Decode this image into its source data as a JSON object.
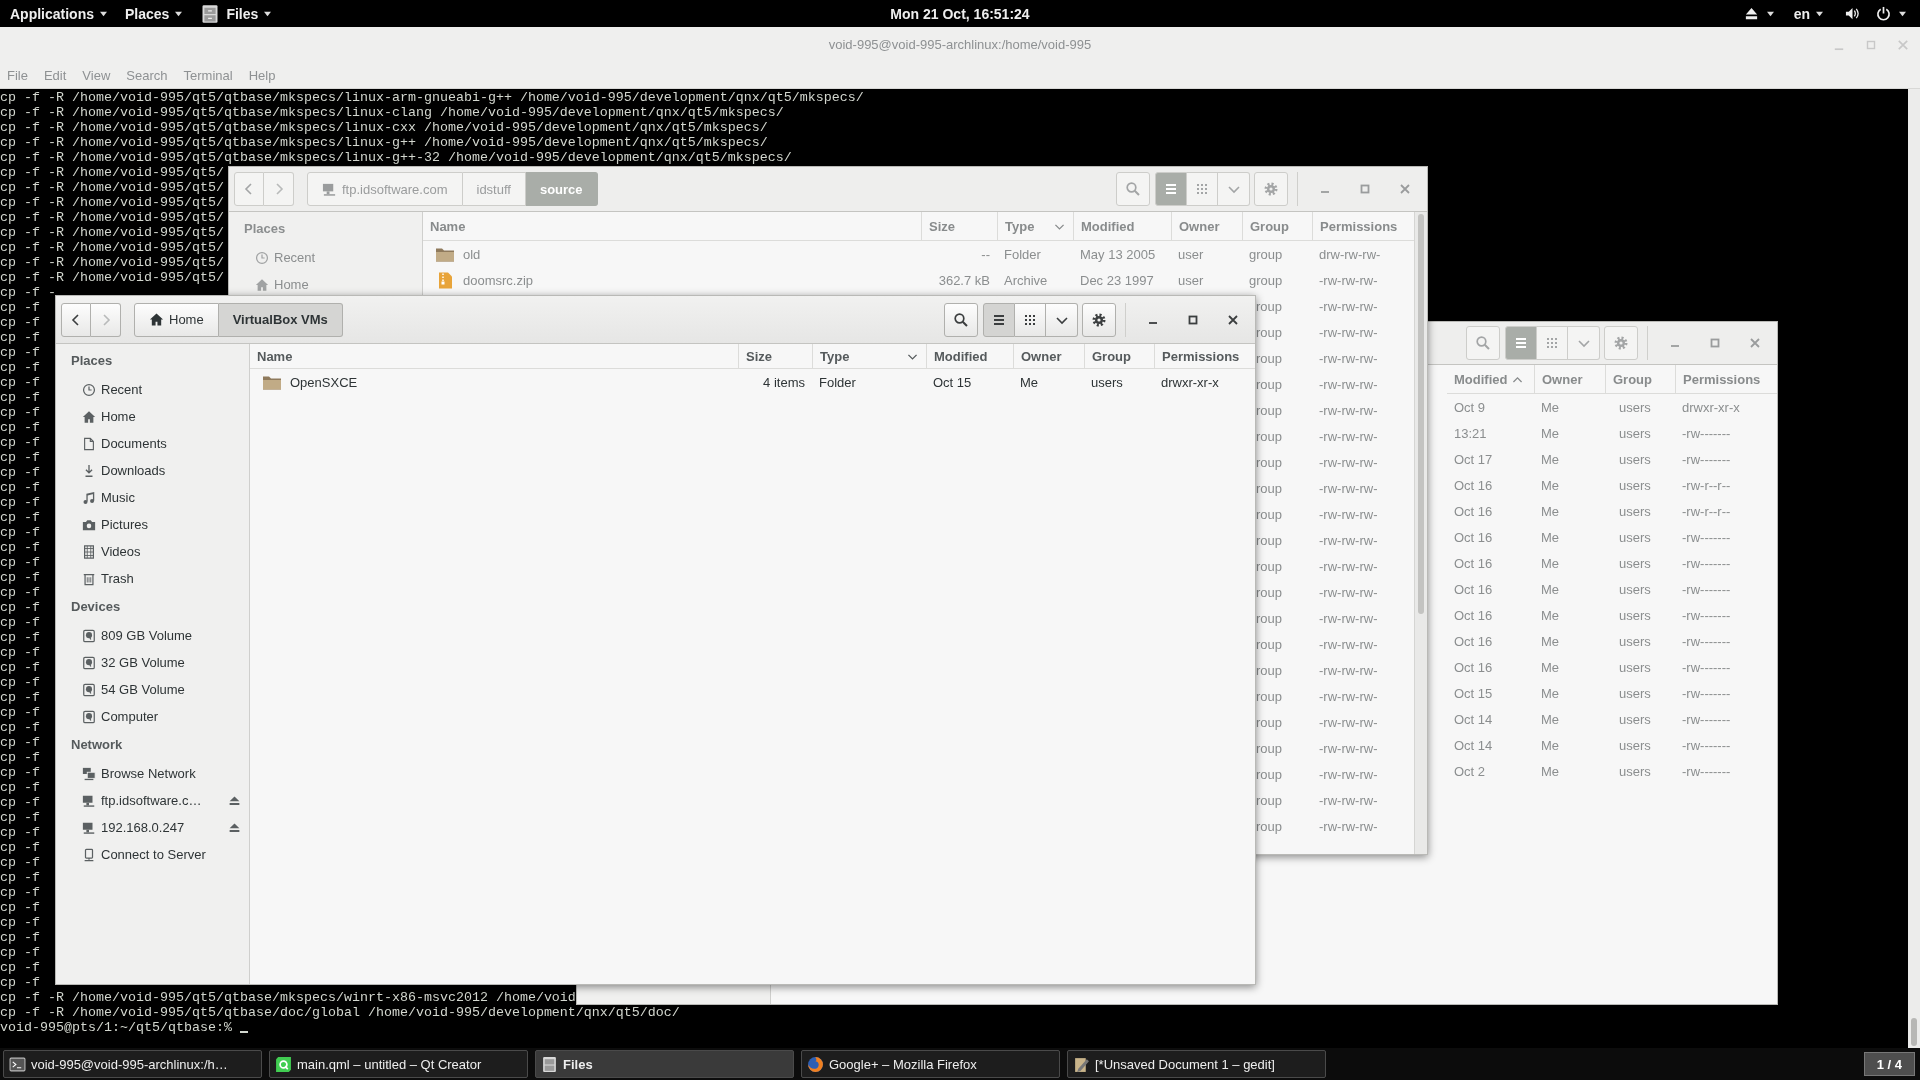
{
  "top_bar": {
    "menus": [
      {
        "label": "Applications"
      },
      {
        "label": "Places"
      },
      {
        "label": "Files"
      }
    ],
    "clock": "Mon 21 Oct, 16:51:24",
    "keyboard_layout": "en"
  },
  "terminal": {
    "title": "void-995@void-995-archlinux:/home/void-995",
    "menu": [
      "File",
      "Edit",
      "View",
      "Search",
      "Terminal",
      "Help"
    ],
    "lines": [
      "cp -f -R /home/void-995/qt5/qtbase/mkspecs/linux-arm-gnueabi-g++ /home/void-995/development/qnx/qt5/mkspecs/",
      "cp -f -R /home/void-995/qt5/qtbase/mkspecs/linux-clang /home/void-995/development/qnx/qt5/mkspecs/",
      "cp -f -R /home/void-995/qt5/qtbase/mkspecs/linux-cxx /home/void-995/development/qnx/qt5/mkspecs/",
      "cp -f -R /home/void-995/qt5/qtbase/mkspecs/linux-g++ /home/void-995/development/qnx/qt5/mkspecs/",
      "cp -f -R /home/void-995/qt5/qtbase/mkspecs/linux-g++-32 /home/void-995/development/qnx/qt5/mkspecs/",
      "cp -f -R /home/void-995/qt5/",
      "cp -f -R /home/void-995/qt5/",
      "cp -f -R /home/void-995/qt5/",
      "cp -f -R /home/void-995/qt5/",
      "cp -f -R /home/void-995/qt5/",
      "cp -f -R /home/void-995/qt5/",
      "cp -f -R /home/void-995/qt5/",
      "cp -f -R /home/void-995/qt5/",
      "cp -f -",
      "cp -f",
      "cp -f",
      "cp -f",
      "cp -f",
      "cp -f",
      "cp -f",
      "cp -f",
      "cp -f",
      "cp -f",
      "cp -f",
      "cp -f",
      "cp -f",
      "cp -f",
      "cp -f",
      "cp -f",
      "cp -f",
      "cp -f",
      "cp -f",
      "cp -f",
      "cp -f",
      "cp -f",
      "cp -f",
      "cp -f",
      "cp -f",
      "cp -f",
      "cp -f",
      "cp -f",
      "cp -f",
      "cp -f",
      "cp -f",
      "cp -f",
      "cp -f",
      "cp -f",
      "cp -f",
      "cp -f",
      "cp -f",
      "cp -f",
      "cp -f",
      "cp -f",
      "cp -f",
      "cp -f",
      "cp -f",
      "cp -f",
      "cp -f",
      "cp -f",
      "cp -f",
      "cp -f -R /home/void-995/qt5/qtbase/mkspecs/winrt-x86-msvc2012 /home/void",
      "cp -f -R /home/void-995/qt5/qtbase/doc/global /home/void-995/development/qnx/qt5/doc/"
    ],
    "prompt": "void-995@pts/1:~/qt5/qtbase:%"
  },
  "window_behind": {
    "focused": false,
    "list_view": true,
    "columns": [
      {
        "label": "Modified",
        "sorted": true,
        "ascending": true
      },
      {
        "label": "Owner",
        "sorted": false
      },
      {
        "label": "Group",
        "sorted": false
      },
      {
        "label": "Permissions",
        "sorted": false
      }
    ],
    "rows": [
      {
        "modified": "Oct 9",
        "owner": "Me",
        "group": "users",
        "permissions": "drwxr-xr-x"
      },
      {
        "modified": "13:21",
        "owner": "Me",
        "group": "users",
        "permissions": "-rw-------"
      },
      {
        "modified": "Oct 17",
        "owner": "Me",
        "group": "users",
        "permissions": "-rw-------"
      },
      {
        "modified": "Oct 16",
        "owner": "Me",
        "group": "users",
        "permissions": "-rw-r--r--"
      },
      {
        "modified": "Oct 16",
        "owner": "Me",
        "group": "users",
        "permissions": "-rw-r--r--"
      },
      {
        "modified": "Oct 16",
        "owner": "Me",
        "group": "users",
        "permissions": "-rw-------"
      },
      {
        "modified": "Oct 16",
        "owner": "Me",
        "group": "users",
        "permissions": "-rw-------"
      },
      {
        "modified": "Oct 16",
        "owner": "Me",
        "group": "users",
        "permissions": "-rw-------"
      },
      {
        "modified": "Oct 16",
        "owner": "Me",
        "group": "users",
        "permissions": "-rw-------"
      },
      {
        "modified": "Oct 16",
        "owner": "Me",
        "group": "users",
        "permissions": "-rw-------"
      },
      {
        "modified": "Oct 16",
        "owner": "Me",
        "group": "users",
        "permissions": "-rw-------"
      },
      {
        "modified": "Oct 15",
        "owner": "Me",
        "group": "users",
        "permissions": "-rw-------"
      },
      {
        "modified": "Oct 14",
        "owner": "Me",
        "group": "users",
        "permissions": "-rw-------"
      },
      {
        "modified": "Oct 14",
        "owner": "Me",
        "group": "users",
        "permissions": "-rw-------"
      },
      {
        "modified": "Oct 2",
        "owner": "Me",
        "group": "users",
        "permissions": "-rw-------"
      }
    ]
  },
  "ftp_window": {
    "focused": false,
    "list_view": true,
    "forward_disabled": true,
    "path": [
      {
        "label": "ftp.idsoftware.com",
        "selected": false
      },
      {
        "label": "idstuff",
        "selected": false
      },
      {
        "label": "source",
        "selected": true
      }
    ],
    "sidebar": [
      {
        "heading": "Places",
        "items": [
          {
            "label": "Recent"
          },
          {
            "label": "Home"
          }
        ]
      }
    ],
    "columns": [
      {
        "label": "Name",
        "sorted": false
      },
      {
        "label": "Size",
        "sorted": false
      },
      {
        "label": "Type",
        "sorted": true,
        "ascending": false
      },
      {
        "label": "Modified",
        "sorted": false
      },
      {
        "label": "Owner",
        "sorted": false
      },
      {
        "label": "Group",
        "sorted": false
      },
      {
        "label": "Permissions",
        "sorted": false
      }
    ],
    "rows": [
      {
        "kind": "folder",
        "name": "old",
        "size": "--",
        "type": "Folder",
        "modified": "May 13 2005",
        "owner": "user",
        "group": "group",
        "permissions": "drw-rw-rw-"
      },
      {
        "kind": "archive",
        "name": "doomsrc.zip",
        "size": "362.7 kB",
        "type": "Archive",
        "modified": "Dec 23 1997",
        "owner": "user",
        "group": "group",
        "permissions": "-rw-rw-rw-"
      },
      {
        "group": "roup",
        "permissions": "-rw-rw-rw-"
      },
      {
        "group": "roup",
        "permissions": "-rw-rw-rw-"
      },
      {
        "group": "roup",
        "permissions": "-rw-rw-rw-"
      },
      {
        "group": "roup",
        "permissions": "-rw-rw-rw-"
      },
      {
        "group": "roup",
        "permissions": "-rw-rw-rw-"
      },
      {
        "group": "roup",
        "permissions": "-rw-rw-rw-"
      },
      {
        "group": "roup",
        "permissions": "-rw-rw-rw-"
      },
      {
        "group": "roup",
        "permissions": "-rw-rw-rw-"
      },
      {
        "group": "roup",
        "permissions": "-rw-rw-rw-"
      },
      {
        "group": "roup",
        "permissions": "-rw-rw-rw-"
      },
      {
        "group": "roup",
        "permissions": "-rw-rw-rw-"
      },
      {
        "group": "roup",
        "permissions": "-rw-rw-rw-"
      },
      {
        "group": "roup",
        "permissions": "-rw-rw-rw-"
      },
      {
        "group": "roup",
        "permissions": "-rw-rw-rw-"
      },
      {
        "group": "roup",
        "permissions": "-rw-rw-rw-"
      },
      {
        "group": "roup",
        "permissions": "-rw-rw-rw-"
      },
      {
        "group": "roup",
        "permissions": "-rw-rw-rw-"
      },
      {
        "group": "roup",
        "permissions": "-rw-rw-rw-"
      },
      {
        "group": "roup",
        "permissions": "-rw-rw-rw-"
      },
      {
        "group": "roup",
        "permissions": "-rw-rw-rw-"
      },
      {
        "group": "roup",
        "permissions": "-rw-rw-rw-"
      }
    ]
  },
  "front_window": {
    "focused": true,
    "list_view": true,
    "forward_disabled": true,
    "path": [
      {
        "label": "Home",
        "selected": false
      },
      {
        "label": "VirtualBox VMs",
        "selected": true
      }
    ],
    "sidebar": [
      {
        "heading": "Places",
        "items": [
          {
            "label": "Recent"
          },
          {
            "label": "Home"
          },
          {
            "label": "Documents"
          },
          {
            "label": "Downloads"
          },
          {
            "label": "Music"
          },
          {
            "label": "Pictures"
          },
          {
            "label": "Videos"
          },
          {
            "label": "Trash"
          }
        ]
      },
      {
        "heading": "Devices",
        "items": [
          {
            "label": "809 GB Volume"
          },
          {
            "label": "32 GB Volume"
          },
          {
            "label": "54 GB Volume"
          },
          {
            "label": "Computer"
          }
        ]
      },
      {
        "heading": "Network",
        "items": [
          {
            "label": "Browse Network",
            "ejectable": false
          },
          {
            "label": "ftp.idsoftware.c…",
            "ejectable": true
          },
          {
            "label": "192.168.0.247",
            "ejectable": true
          },
          {
            "label": "Connect to Server",
            "ejectable": false
          }
        ]
      }
    ],
    "columns": [
      {
        "label": "Name",
        "sorted": false
      },
      {
        "label": "Size",
        "sorted": false
      },
      {
        "label": "Type",
        "sorted": true,
        "ascending": false
      },
      {
        "label": "Modified",
        "sorted": false
      },
      {
        "label": "Owner",
        "sorted": false
      },
      {
        "label": "Group",
        "sorted": false
      },
      {
        "label": "Permissions",
        "sorted": false
      }
    ],
    "rows": [
      {
        "kind": "folder",
        "name": "OpenSXCE",
        "size": "4 items",
        "type": "Folder",
        "modified": "Oct 15",
        "owner": "Me",
        "group": "users",
        "permissions": "drwxr-xr-x"
      }
    ]
  },
  "taskbar": {
    "items": [
      {
        "label": "void-995@void-995-archlinux:/h…",
        "selected": false
      },
      {
        "label": "main.qml – untitled – Qt Creator",
        "selected": false
      },
      {
        "label": "Files",
        "selected": true
      },
      {
        "label": "Google+ – Mozilla Firefox",
        "selected": false
      },
      {
        "label": "[*Unsaved Document 1 – gedit]",
        "selected": false
      }
    ],
    "workspace": "1 / 4"
  }
}
